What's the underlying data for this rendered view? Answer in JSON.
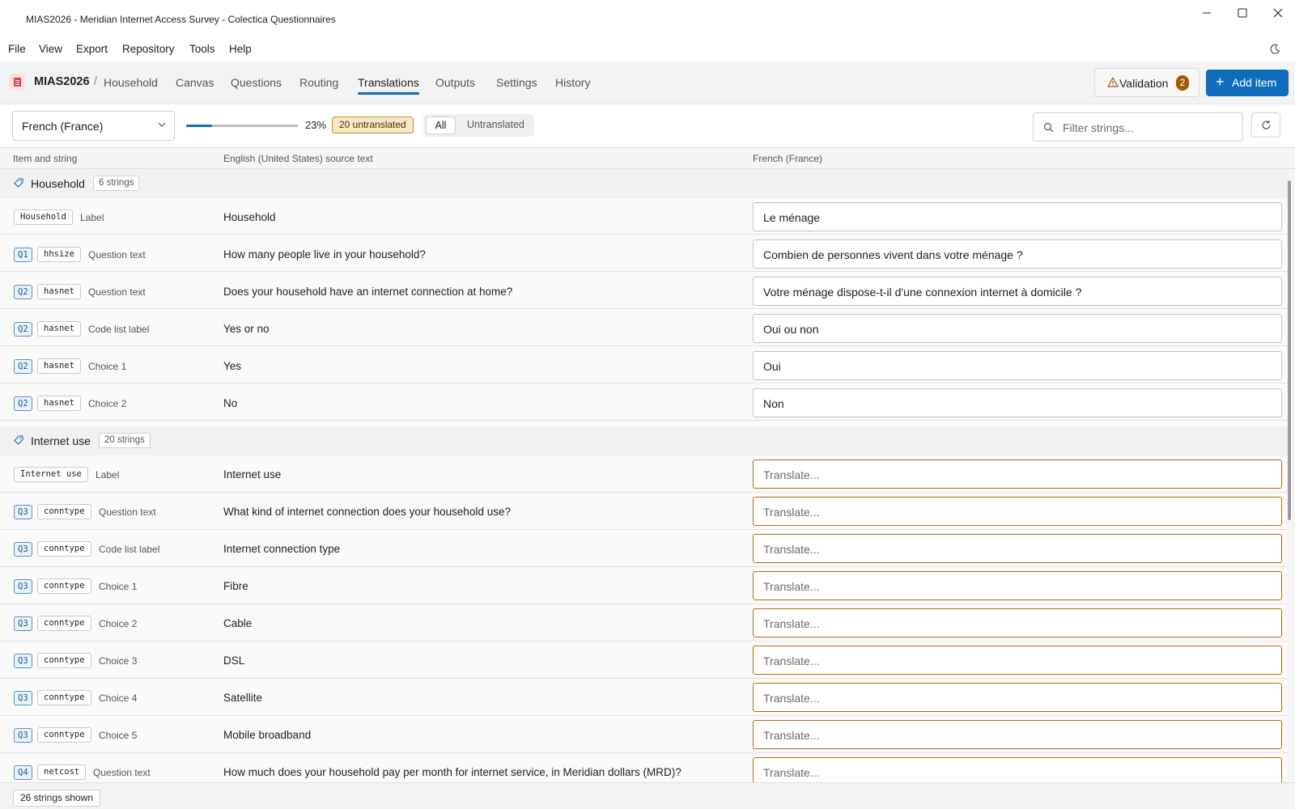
{
  "window": {
    "title": "MIAS2026 - Meridian Internet Access Survey - Colectica Questionnaires"
  },
  "menu": [
    "File",
    "View",
    "Export",
    "Repository",
    "Tools",
    "Help"
  ],
  "breadcrumb": {
    "project": "MIAS2026",
    "separator": "/",
    "page": "Household"
  },
  "tabs": [
    "Canvas",
    "Questions",
    "Routing",
    "Translations",
    "Outputs",
    "Settings",
    "History"
  ],
  "active_tab": "Translations",
  "toolbar": {
    "validation_label": "Validation",
    "validation_count": "2",
    "add_label": "Add item",
    "add_symbol": "+"
  },
  "filter": {
    "language": "French (France)",
    "progress_fraction": 0.23,
    "progress_text": "23%",
    "untranslated_badge": "20 untranslated",
    "segment_all": "All",
    "segment_untranslated": "Untranslated",
    "search_placeholder": "Filter strings..."
  },
  "columns": {
    "item": "Item and string",
    "source": "English (United States) source text",
    "target": "French (France)"
  },
  "groups": [
    {
      "name": "Household",
      "count": "6 strings",
      "rows": [
        {
          "q": "",
          "name": "Household",
          "kind": "Label",
          "source": "Household",
          "translation": "Le ménage"
        },
        {
          "q": "Q1",
          "name": "hhsize",
          "kind": "Question text",
          "source": "How many people live in your household?",
          "translation": "Combien de personnes vivent dans votre ménage ?"
        },
        {
          "q": "Q2",
          "name": "hasnet",
          "kind": "Question text",
          "source": "Does your household have an internet connection at home?",
          "translation": "Votre ménage dispose-t-il d'une connexion internet à domicile ?"
        },
        {
          "q": "Q2",
          "name": "hasnet",
          "kind": "Code list label",
          "source": "Yes or no",
          "translation": "Oui ou non"
        },
        {
          "q": "Q2",
          "name": "hasnet",
          "kind": "Choice 1",
          "source": "Yes",
          "translation": "Oui"
        },
        {
          "q": "Q2",
          "name": "hasnet",
          "kind": "Choice 2",
          "source": "No",
          "translation": "Non"
        }
      ]
    },
    {
      "name": "Internet use",
      "count": "20 strings",
      "rows": [
        {
          "q": "",
          "name": "Internet use",
          "kind": "Label",
          "source": "Internet use",
          "translation": ""
        },
        {
          "q": "Q3",
          "name": "conntype",
          "kind": "Question text",
          "source": "What kind of internet connection does your household use?",
          "translation": ""
        },
        {
          "q": "Q3",
          "name": "conntype",
          "kind": "Code list label",
          "source": "Internet connection type",
          "translation": ""
        },
        {
          "q": "Q3",
          "name": "conntype",
          "kind": "Choice 1",
          "source": "Fibre",
          "translation": ""
        },
        {
          "q": "Q3",
          "name": "conntype",
          "kind": "Choice 2",
          "source": "Cable",
          "translation": ""
        },
        {
          "q": "Q3",
          "name": "conntype",
          "kind": "Choice 3",
          "source": "DSL",
          "translation": ""
        },
        {
          "q": "Q3",
          "name": "conntype",
          "kind": "Choice 4",
          "source": "Satellite",
          "translation": ""
        },
        {
          "q": "Q3",
          "name": "conntype",
          "kind": "Choice 5",
          "source": "Mobile broadband",
          "translation": ""
        },
        {
          "q": "Q4",
          "name": "netcost",
          "kind": "Question text",
          "source": "How much does your household pay per month for internet service, in Meridian dollars (MRD)?",
          "translation": ""
        }
      ]
    }
  ],
  "translate_placeholder": "Translate...",
  "status": {
    "shown": "26 strings shown"
  },
  "colors": {
    "accent": "#0f6cbd",
    "untranslated_border": "#b86b0c",
    "badge_bg": "#fbe7c4"
  }
}
